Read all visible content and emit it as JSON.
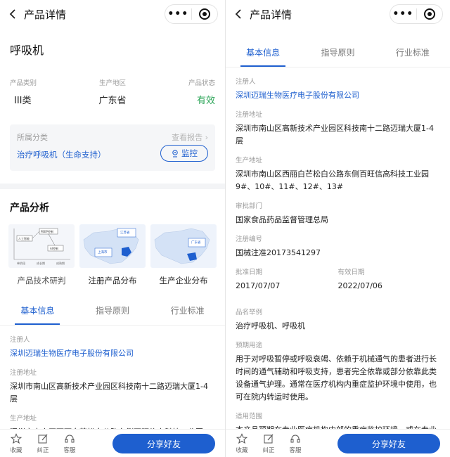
{
  "navbar": {
    "title": "产品详情",
    "more_glyph": "•••"
  },
  "product": {
    "name": "呼吸机",
    "category_label": "产品类别",
    "category_value": "III类",
    "region_label": "生产地区",
    "region_value": "广东省",
    "status_label": "产品状态",
    "status_value": "有效"
  },
  "classification": {
    "label": "所属分类",
    "report_link": "查看报告",
    "value": "治疗呼吸机（生命支持）",
    "monitor_label": "监控"
  },
  "analysis": {
    "title": "产品分析",
    "cards": [
      {
        "label": "产品技术研判"
      },
      {
        "label": "注册产品分布"
      },
      {
        "label": "生产企业分布"
      }
    ],
    "thumb_texts": {
      "t1": "人工智能",
      "t2": "PEEP控制",
      "t3": "AI控制",
      "x1": "单阶段",
      "x2": "成长期",
      "x3": "成熟期",
      "jiangsu": "江苏省",
      "shanghai": "上海市",
      "guangdong": "广东省"
    }
  },
  "tabs": [
    "基本信息",
    "指导原则",
    "行业标准"
  ],
  "details": {
    "registrant_label": "注册人",
    "registrant_value": "深圳迈瑞生物医疗电子股份有限公司",
    "reg_addr_label": "注册地址",
    "reg_addr_value": "深圳市南山区高新技术产业园区科技南十二路迈瑞大厦1-4层",
    "prod_addr_label": "生产地址",
    "prod_addr_value": "深圳市南山区西丽白芒松白公路东侧百旺信高科技工业园9#、10#、11#、12#、13#",
    "dept_label": "审批部门",
    "dept_value": "国家食品药品监督管理总局",
    "regno_label": "注册编号",
    "regno_value": "国械注准20173541297",
    "approve_label": "批准日期",
    "approve_value": "2017/07/07",
    "valid_label": "有效日期",
    "valid_value": "2022/07/06",
    "name_list_label": "品名举例",
    "name_list_value": "治疗呼吸机、呼吸机",
    "usage_label": "预期用途",
    "usage_value": "用于对呼吸暂停或呼吸衰竭、依赖于机械通气的患者进行长时间的通气辅助和呼吸支持，患者完全依靠或部分依靠此类设备通气护理。通常在医疗机构内重症监护环境中使用，也可在院内转运时使用。",
    "scope_label": "适用范围",
    "scope_value": "本产品预期在专业医疗机构内部的重症监护环境，或在专业医疗机构内部进行转运时使用。用于对成人、小儿和婴"
  },
  "bottom": {
    "favorite": "收藏",
    "correct": "纠正",
    "service": "客服",
    "share": "分享好友"
  },
  "colors": {
    "accent": "#1e5fcf",
    "status_green": "#2aa456"
  }
}
